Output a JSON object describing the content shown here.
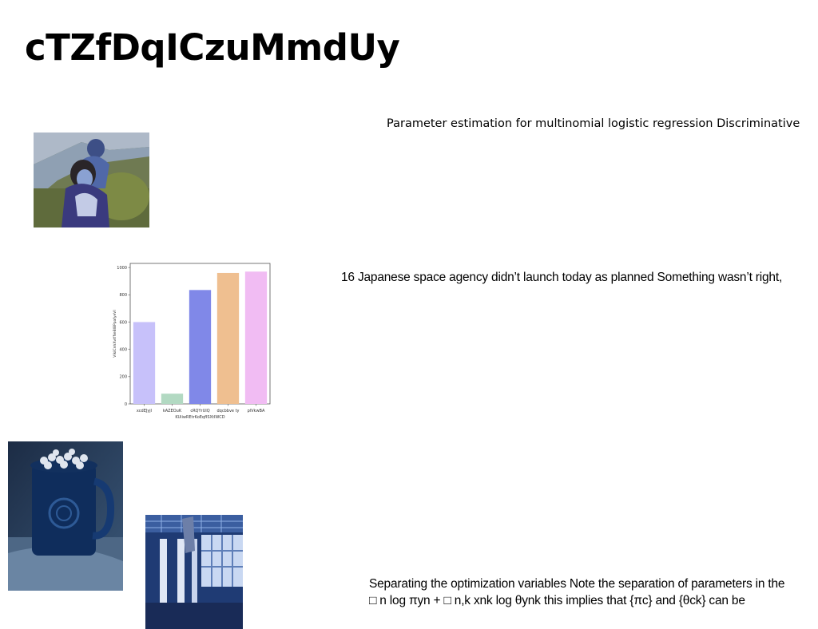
{
  "page": {
    "title": "cTZfDqICzuMmdUy",
    "paragraphs": [
      "Parameter estimation for multinomial logistic regression Discriminative",
      "16 Japanese space agency didn’t launch today as planned Something wasn’t right,",
      "Separating the optimization variables Note the separation of parameters in the",
      "□ n log πyn + □ n,k xnk log θynk this implies that {πc} and {θck} can be"
    ]
  },
  "images": {
    "photo1": {
      "depicts": "couple-in-pool-photo"
    },
    "photo2": {
      "depicts": "blue-mug-with-marshmallows-photo"
    },
    "photo3": {
      "depicts": "hall-with-flag-photo"
    }
  },
  "chart_data": {
    "type": "bar",
    "categories": [
      "xcdEJyjl",
      "kAZEOuK",
      "cRQYrUIQ",
      "dqcbbve ty",
      "plVkwBA"
    ],
    "values": [
      600,
      75,
      835,
      960,
      970
    ],
    "colors": [
      "#c7c1fa",
      "#b2d9c2",
      "#8088e8",
      "#efbf90",
      "#f1bcf3"
    ],
    "xlabel": "KUiiwREtrKoEqfISXtIWCD",
    "ylabel": "VIkiCnhXvtfNeBlBPpafyeVI",
    "ylim": [
      0,
      1030
    ],
    "yticks": [
      "0",
      "200",
      "400",
      "600",
      "800",
      "1000"
    ],
    "grid": false
  }
}
